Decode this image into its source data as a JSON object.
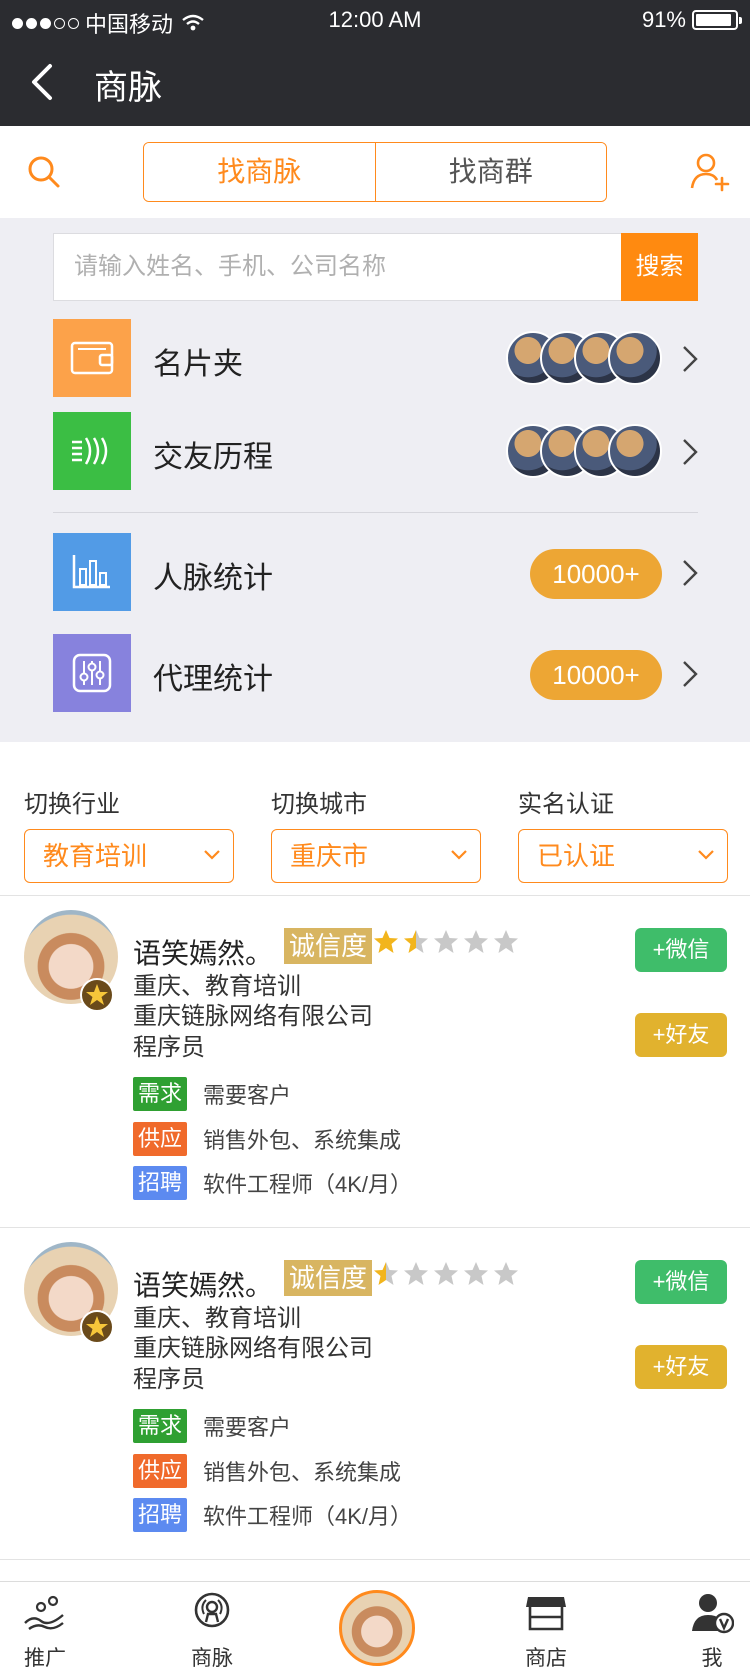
{
  "status": {
    "carrier": "中国移动",
    "time": "12:00 AM",
    "battery": "91%",
    "battery_level": 0.91
  },
  "nav": {
    "title": "商脉"
  },
  "segment": {
    "tab1": "找商脉",
    "tab2": "找商群",
    "active": 0
  },
  "search": {
    "placeholder": "请输入姓名、手机、公司名称",
    "button": "搜索"
  },
  "menu": [
    {
      "label": "名片夹",
      "icon": "wallet-icon",
      "color": "#fca24a"
    },
    {
      "label": "交友历程",
      "icon": "wave-icon",
      "color": "#3bbe44"
    },
    {
      "label": "人脉统计",
      "icon": "bar-chart-icon",
      "color": "#529be6",
      "badge": "10000+"
    },
    {
      "label": "代理统计",
      "icon": "sliders-icon",
      "color": "#8782dd",
      "badge": "10000+"
    }
  ],
  "filters": [
    {
      "label": "切换行业",
      "value": "教育培训"
    },
    {
      "label": "切换城市",
      "value": "重庆市"
    },
    {
      "label": "实名认证",
      "value": "已认证"
    }
  ],
  "cards": [
    {
      "name": "语笑嫣然。",
      "cred": "诚信度",
      "rating": 1.5,
      "location": "重庆、教育培训",
      "company": "重庆链脉网络有限公司",
      "role": "程序员",
      "wechat": "+微信",
      "friend": "+好友",
      "tags": [
        {
          "label": "需求",
          "value": "需要客户"
        },
        {
          "label": "供应",
          "value": "销售外包、系统集成"
        },
        {
          "label": "招聘",
          "value": "软件工程师（4K/月）"
        }
      ]
    },
    {
      "name": "语笑嫣然。",
      "cred": "诚信度",
      "rating": 0.5,
      "location": "重庆、教育培训",
      "company": "重庆链脉网络有限公司",
      "role": "程序员",
      "wechat": "+微信",
      "friend": "+好友",
      "tags": [
        {
          "label": "需求",
          "value": "需要客户"
        },
        {
          "label": "供应",
          "value": "销售外包、系统集成"
        },
        {
          "label": "招聘",
          "value": "软件工程师（4K/月）"
        }
      ]
    }
  ],
  "tabbar": {
    "tab1": "推广",
    "tab2": "商脉",
    "tab4": "商店",
    "tab5": "我"
  }
}
